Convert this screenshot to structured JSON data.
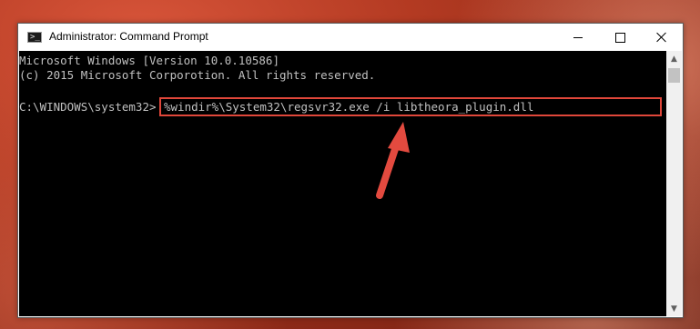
{
  "window": {
    "title": "Administrator: Command Prompt",
    "icon_text": ">_",
    "controls": {
      "minimize": "minimize-icon",
      "maximize": "maximize-icon",
      "close": "close-icon"
    }
  },
  "console": {
    "line1": "Microsoft Windows [Version 10.0.10586]",
    "line2": "(c) 2015 Microsoft Corporotion. All rights reserved.",
    "prompt": "C:\\WINDOWS\\system32>",
    "command": "%windir%\\System32\\regsvr32.exe /i libtheora_plugin.dll"
  },
  "scrollbar": {
    "up": "▲",
    "down": "▼"
  },
  "colors": {
    "console_bg": "#000000",
    "console_text": "#c0c0c0",
    "highlight": "#e0473a",
    "arrow": "#e34a3f"
  }
}
